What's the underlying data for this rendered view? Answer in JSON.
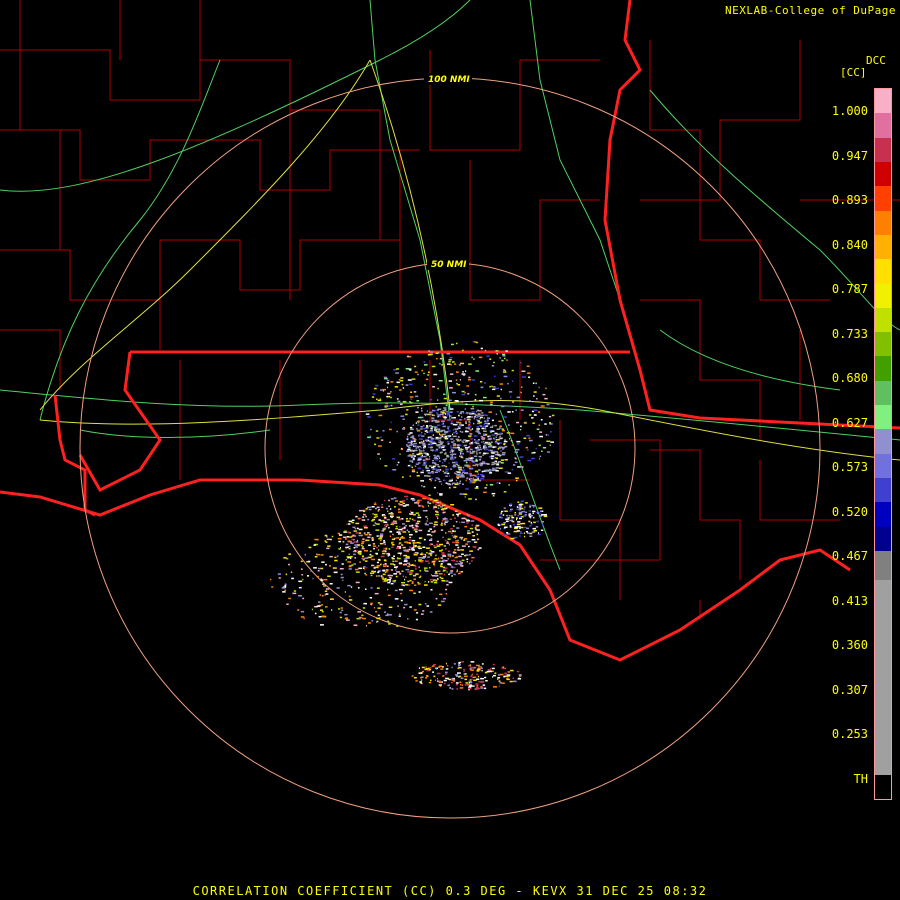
{
  "credit": "NEXLAB-College of DuPage",
  "product_code": "DCC",
  "unit_label": "[CC]",
  "range_rings": [
    {
      "label": "100 NMI"
    },
    {
      "label": "50 NMI"
    }
  ],
  "colorbar": {
    "ticks": [
      "1.000",
      "0.947",
      "0.893",
      "0.840",
      "0.787",
      "0.733",
      "0.680",
      "0.627",
      "0.573",
      "0.520",
      "0.467",
      "0.413",
      "0.360",
      "0.307",
      "0.253",
      "TH"
    ],
    "colors": [
      "#f8b0c8",
      "#e070a0",
      "#c83050",
      "#d00000",
      "#ff4000",
      "#ff8000",
      "#ffb000",
      "#ffe000",
      "#f0f000",
      "#c0e000",
      "#80c000",
      "#40a000",
      "#60c060",
      "#80f080",
      "#9090d0",
      "#7070e0",
      "#4040d0",
      "#0000c0",
      "#000090",
      "#808080",
      "#a0a0a0",
      "#000000"
    ]
  },
  "footer": "CORRELATION COEFFICIENT (CC) 0.3 DEG - KEVX 31 DEC 25 08:32"
}
